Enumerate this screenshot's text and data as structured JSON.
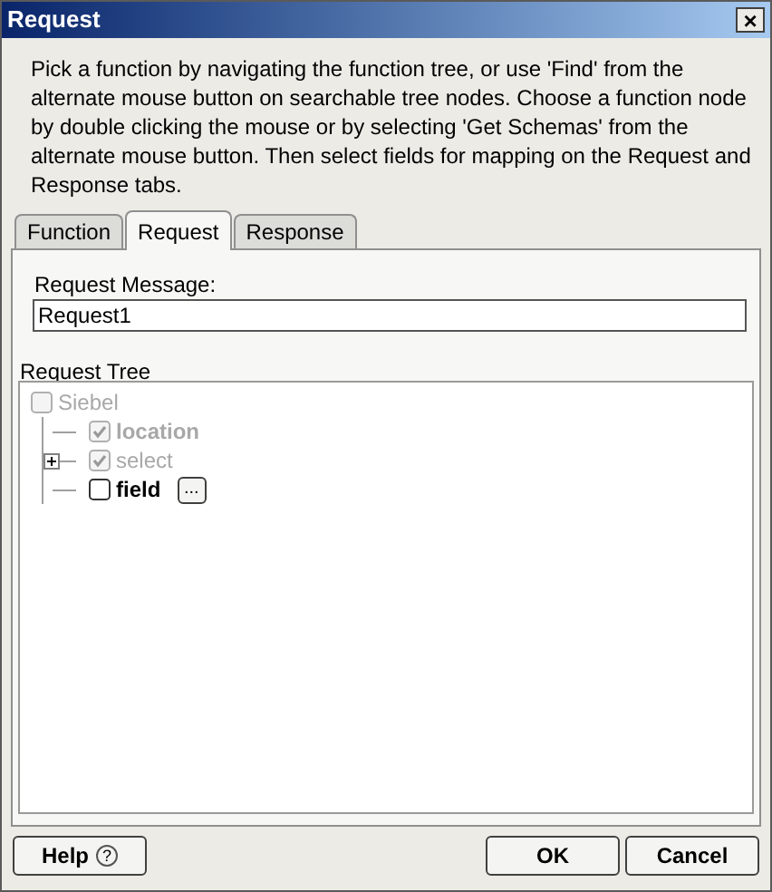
{
  "window": {
    "title": "Request",
    "close": "×"
  },
  "instructions": "Pick a function by navigating the function tree, or use 'Find' from the alternate mouse button on searchable tree nodes. Choose a function node by double clicking the mouse or by selecting 'Get Schemas' from the alternate mouse button. Then select fields for mapping on the Request and Response tabs.",
  "tabs": [
    {
      "label": "Function",
      "selected": false
    },
    {
      "label": "Request",
      "selected": true
    },
    {
      "label": "Response",
      "selected": false
    }
  ],
  "request_message": {
    "label": "Request Message:",
    "value": "Request1"
  },
  "request_tree": {
    "label": "Request Tree",
    "nodes": [
      {
        "label": "Siebel",
        "checked": false,
        "disabled": true,
        "bold": false,
        "collapsed": false,
        "children": [
          {
            "label": "location",
            "checked": true,
            "disabled": true,
            "bold": true,
            "collapsed": false
          },
          {
            "label": "select",
            "checked": true,
            "disabled": true,
            "bold": false,
            "collapsed": true
          },
          {
            "label": "field",
            "checked": false,
            "disabled": false,
            "bold": true,
            "collapsed": false,
            "button": "..."
          }
        ]
      }
    ]
  },
  "buttons": {
    "help": "Help",
    "help_icon": "?",
    "ok": "OK",
    "cancel": "Cancel"
  }
}
